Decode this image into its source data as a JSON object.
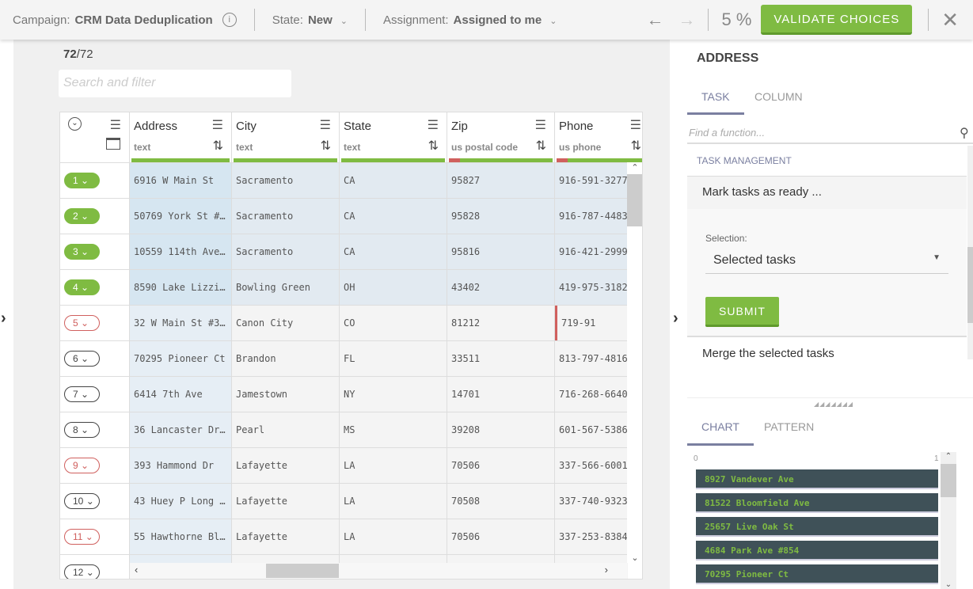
{
  "topbar": {
    "campaign_label": "Campaign:",
    "campaign": "CRM Data Deduplication",
    "state_label": "State:",
    "state": "New",
    "assignment_label": "Assignment:",
    "assignment": "Assigned to me",
    "progress": "5 %",
    "validate": "VALIDATE CHOICES"
  },
  "count": {
    "shown": "72",
    "total": "/72"
  },
  "search_placeholder": "Search and filter",
  "columns": [
    {
      "name": "Address",
      "type": "text"
    },
    {
      "name": "City",
      "type": "text"
    },
    {
      "name": "State",
      "type": "text"
    },
    {
      "name": "Zip",
      "type": "us postal code"
    },
    {
      "name": "Phone",
      "type": "us phone"
    }
  ],
  "rows": [
    {
      "n": "1",
      "status": "valid",
      "cells": [
        "6916 W Main St",
        "Sacramento",
        "CA",
        "95827",
        "916-591-3277"
      ]
    },
    {
      "n": "2",
      "status": "valid",
      "cells": [
        "50769 York St #…",
        "Sacramento",
        "CA",
        "95828",
        "916-787-4483"
      ]
    },
    {
      "n": "3",
      "status": "valid",
      "cells": [
        "10559 114th Ave…",
        "Sacramento",
        "CA",
        "95816",
        "916-421-2999"
      ]
    },
    {
      "n": "4",
      "status": "valid",
      "cells": [
        "8590 Lake Lizzi…",
        "Bowling Green",
        "OH",
        "43402",
        "419-975-3182"
      ]
    },
    {
      "n": "5",
      "status": "invalid",
      "cells": [
        "32 W Main St #3…",
        "Canon City",
        "CO",
        "81212",
        "719-91"
      ]
    },
    {
      "n": "6",
      "status": "none",
      "cells": [
        "70295 Pioneer Ct",
        "Brandon",
        "FL",
        "33511",
        "813-797-4816"
      ]
    },
    {
      "n": "7",
      "status": "none",
      "cells": [
        "6414 7th Ave",
        "Jamestown",
        "NY",
        "14701",
        "716-268-6640"
      ]
    },
    {
      "n": "8",
      "status": "none",
      "cells": [
        "36 Lancaster Dr…",
        "Pearl",
        "MS",
        "39208",
        "601-567-5386"
      ]
    },
    {
      "n": "9",
      "status": "invalid",
      "cells": [
        "393 Hammond Dr",
        "Lafayette",
        "LA",
        "70506",
        "337-566-6001"
      ]
    },
    {
      "n": "10",
      "status": "none",
      "cells": [
        "43 Huey P Long …",
        "Lafayette",
        "LA",
        "70508",
        "337-740-9323"
      ]
    },
    {
      "n": "11",
      "status": "invalid",
      "cells": [
        "55 Hawthorne Bl…",
        "Lafayette",
        "LA",
        "70506",
        "337-253-8384"
      ]
    },
    {
      "n": "12",
      "status": "none",
      "cells": [
        "",
        "",
        "",
        "",
        ""
      ]
    }
  ],
  "panel": {
    "title": "ADDRESS",
    "tabs": [
      "TASK",
      "COLUMN"
    ],
    "find_placeholder": "Find a function...",
    "section": "TASK MANAGEMENT",
    "item1": "Mark tasks as ready ...",
    "selection_label": "Selection:",
    "selection_value": "Selected tasks",
    "submit": "SUBMIT",
    "item2": "Merge the selected tasks",
    "bottom_tabs": [
      "CHART",
      "PATTERN"
    ],
    "chart_min": "0",
    "chart_max": "1",
    "chart_items": [
      "8927 Vandever Ave",
      "81522 Bloomfield Ave",
      "25657 Live Oak St",
      "4684 Park Ave #854",
      "70295 Pioneer Ct"
    ]
  }
}
